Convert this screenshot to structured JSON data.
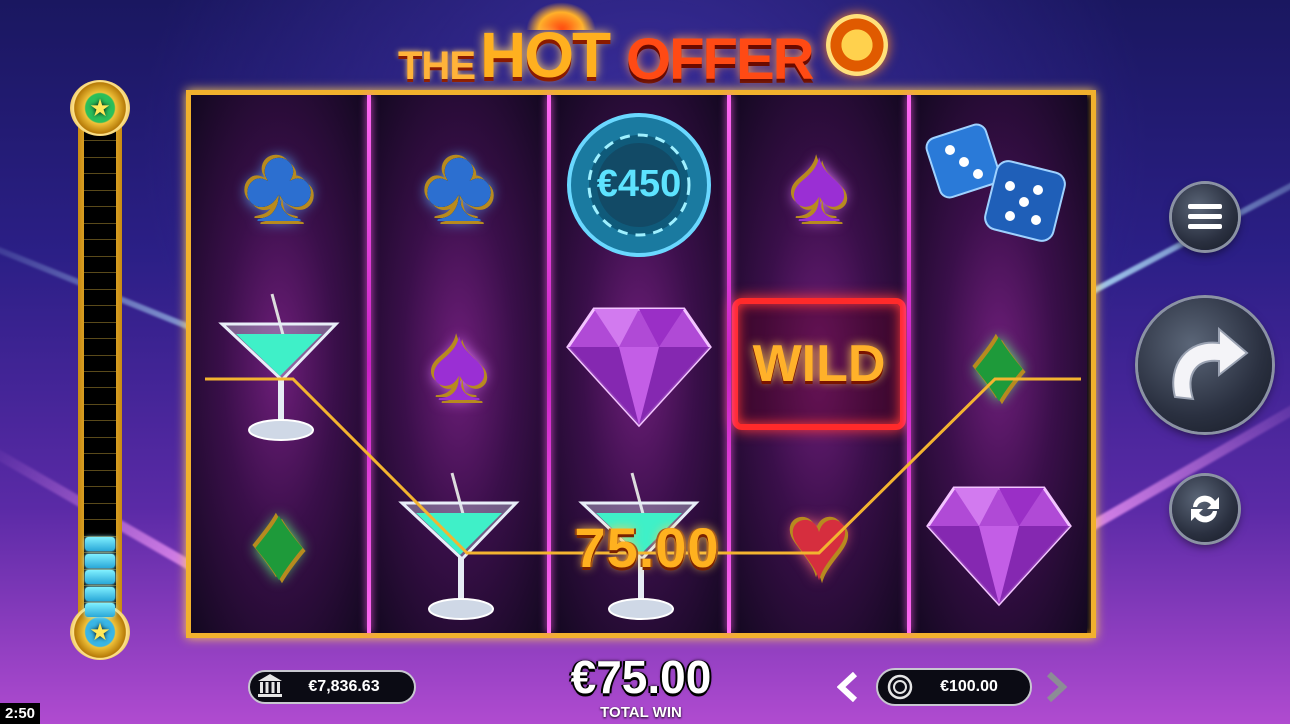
{
  "logo": {
    "the": "THE",
    "hot": "HOT",
    "offer": "OFFER"
  },
  "reels": [
    [
      "club-blue",
      "martini",
      "diamond-green"
    ],
    [
      "club-blue",
      "spade-purple",
      "martini"
    ],
    [
      "chip",
      "gem",
      "martini"
    ],
    [
      "spade-purple",
      "wild",
      "heart-red"
    ],
    [
      "dice",
      "diamond-green",
      "gem"
    ]
  ],
  "chip_symbol": {
    "value": "€450"
  },
  "wild_symbol": {
    "label": "WILD"
  },
  "win": {
    "line_amount": "75.00",
    "total_value": "€75.00",
    "total_label": "TOTAL WIN"
  },
  "balance": {
    "value": "€7,836.63"
  },
  "bet": {
    "value": "€100.00"
  },
  "meter": {
    "fill_fraction": 0.18
  },
  "clock": {
    "time": "2:50"
  },
  "colors": {
    "frame_gold": "#f1b12d",
    "reel_divider": "#ff6af3",
    "win_text": "#ffb11f"
  }
}
